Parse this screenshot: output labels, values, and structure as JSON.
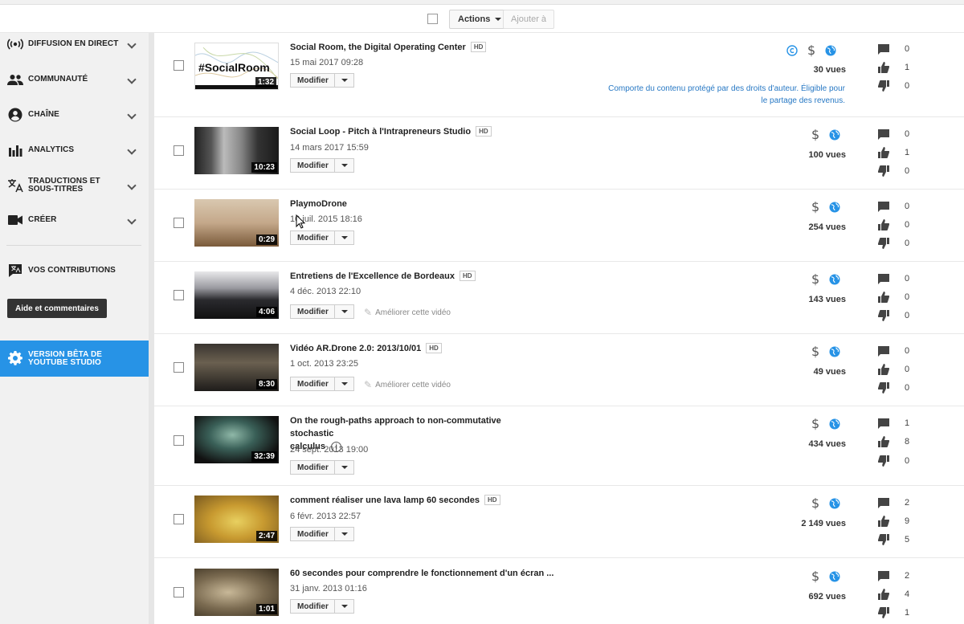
{
  "toolbar": {
    "actions_label": "Actions",
    "add_to_label": "Ajouter à"
  },
  "sidebar": {
    "items": [
      {
        "label": "DIFFUSION EN DIRECT",
        "icon": "live-broadcast-icon"
      },
      {
        "label": "COMMUNAUTÉ",
        "icon": "community-people-icon"
      },
      {
        "label": "CHAÎNE",
        "icon": "channel-person-icon"
      },
      {
        "label": "ANALYTICS",
        "icon": "analytics-bars-icon"
      },
      {
        "label_line1": "TRADUCTIONS ET",
        "label_line2": "SOUS-TITRES",
        "icon": "translate-icon"
      },
      {
        "label": "CRÉER",
        "icon": "video-camera-icon"
      }
    ],
    "contributions_label": "VOS CONTRIBUTIONS",
    "help_label": "Aide et commentaires",
    "beta_line1": "VERSION BÊTA DE",
    "beta_line2": "YOUTUBE STUDIO"
  },
  "common": {
    "modify_label": "Modifier",
    "improve_label": "Améliorer cette vidéo",
    "hd_badge": "HD",
    "accent_color": "#2793e6",
    "link_color": "#2778c4"
  },
  "videos": [
    {
      "title": "Social Room, the Digital Operating Center",
      "hd": true,
      "date": "15 mai 2017 09:28",
      "duration": "1:32",
      "thumb_text": "#SocialRoom",
      "views": "30 vues",
      "comments": "0",
      "likes": "1",
      "dislikes": "0",
      "copyright": true,
      "copyright_note_line1": "Comporte du contenu protégé par des droits d'auteur. Éligible pour",
      "copyright_note_line2": "le partage des revenus."
    },
    {
      "title": "Social Loop - Pitch à l'Intrapreneurs Studio",
      "hd": true,
      "date": "14 mars 2017 15:59",
      "duration": "10:23",
      "views": "100 vues",
      "comments": "0",
      "likes": "1",
      "dislikes": "0"
    },
    {
      "title": "PlaymoDrone",
      "hd": false,
      "date": "10 juil. 2015 18:16",
      "duration": "0:29",
      "views": "254 vues",
      "comments": "0",
      "likes": "0",
      "dislikes": "0"
    },
    {
      "title": "Entretiens de l'Excellence de Bordeaux",
      "hd": true,
      "date": "4 déc. 2013 22:10",
      "duration": "4:06",
      "views": "143 vues",
      "comments": "0",
      "likes": "0",
      "dislikes": "0",
      "improve": true
    },
    {
      "title": "Vidéo AR.Drone 2.0: 2013/10/01",
      "hd": true,
      "date": "1 oct. 2013 23:25",
      "duration": "8:30",
      "views": "49 vues",
      "comments": "0",
      "likes": "0",
      "dislikes": "0",
      "improve": true
    },
    {
      "title_line1": "On the rough-paths approach to non-commutative stochastic",
      "title_line2": "calculus",
      "hd": false,
      "date": "24 sept. 2013 19:00",
      "duration": "32:39",
      "views": "434 vues",
      "comments": "1",
      "likes": "8",
      "dislikes": "0"
    },
    {
      "title": "comment réaliser une lava lamp 60 secondes",
      "hd": true,
      "date": "6 févr. 2013 22:57",
      "duration": "2:47",
      "views": "2 149 vues",
      "comments": "2",
      "likes": "9",
      "dislikes": "5"
    },
    {
      "title": "60 secondes pour comprendre le fonctionnement d'un écran  ...",
      "hd": false,
      "date": "31 janv. 2013 01:16",
      "duration": "1:01",
      "views": "692 vues",
      "comments": "2",
      "likes": "4",
      "dislikes": "1"
    }
  ]
}
